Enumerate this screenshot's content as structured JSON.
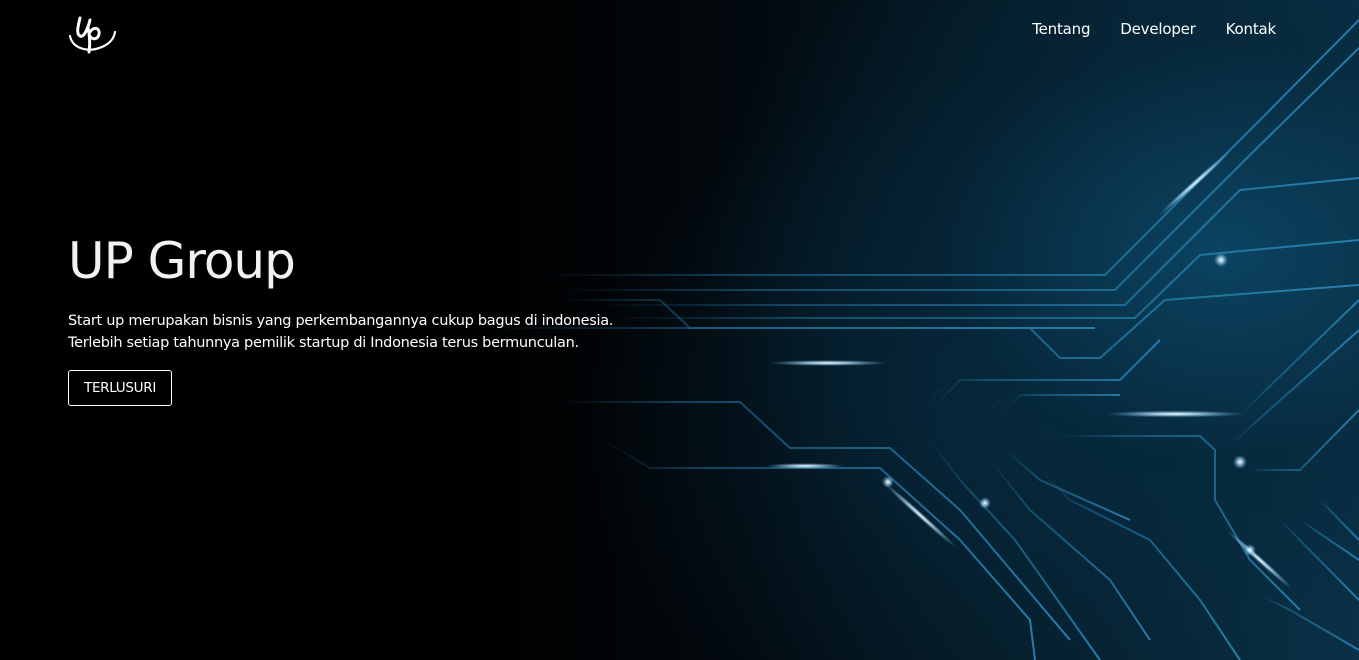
{
  "brand": {
    "logo_text": "Up"
  },
  "nav": {
    "items": [
      {
        "label": "Tentang"
      },
      {
        "label": "Developer"
      },
      {
        "label": "Kontak"
      }
    ]
  },
  "hero": {
    "title": "UP Group",
    "description_lines": [
      "Start up merupakan bisnis yang perkembangannya cukup bagus di indonesia.",
      "Terlebih setiap tahunnya pemilik startup di Indonesia terus bermunculan."
    ],
    "cta_label": "TERLUSURI"
  },
  "colors": {
    "background": "#000000",
    "circuit_line": "#1d6f9a",
    "glow": "#e8f6ff",
    "text": "#ffffff"
  }
}
